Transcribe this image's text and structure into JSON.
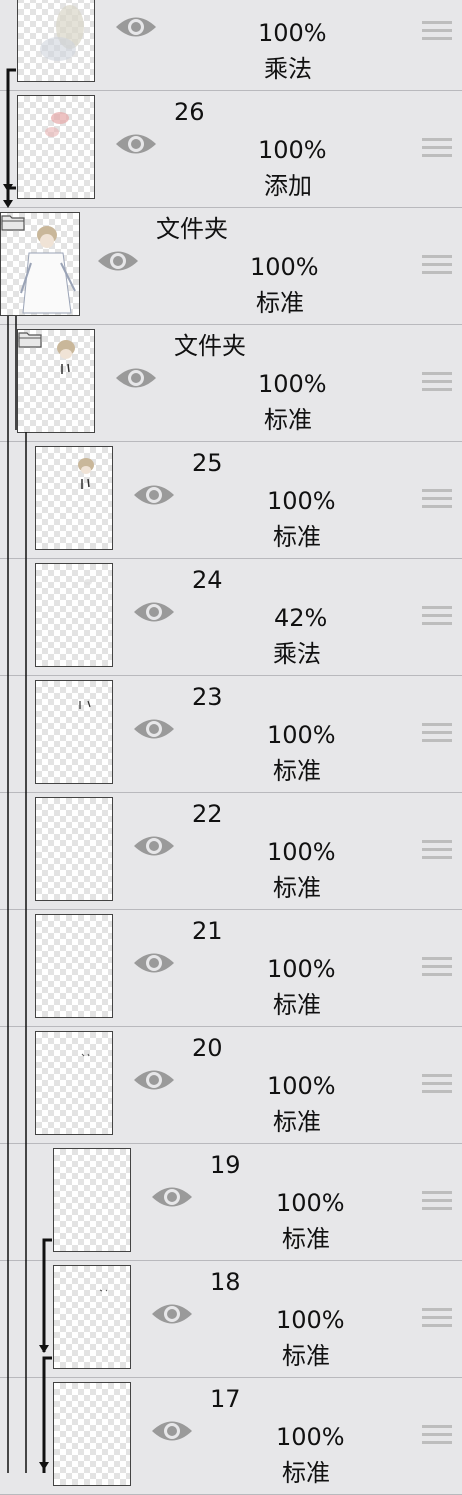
{
  "layers": [
    {
      "name": "",
      "opacity": "100%",
      "blend": "乘法",
      "folder": false
    },
    {
      "name": "26",
      "opacity": "100%",
      "blend": "添加",
      "folder": false
    },
    {
      "name": "文件夹",
      "opacity": "100%",
      "blend": "标准",
      "folder": true
    },
    {
      "name": "文件夹",
      "opacity": "100%",
      "blend": "标准",
      "folder": true
    },
    {
      "name": "25",
      "opacity": "100%",
      "blend": "标准",
      "folder": false
    },
    {
      "name": "24",
      "opacity": "42%",
      "blend": "乘法",
      "folder": false
    },
    {
      "name": "23",
      "opacity": "100%",
      "blend": "标准",
      "folder": false
    },
    {
      "name": "22",
      "opacity": "100%",
      "blend": "标准",
      "folder": false
    },
    {
      "name": "21",
      "opacity": "100%",
      "blend": "标准",
      "folder": false
    },
    {
      "name": "20",
      "opacity": "100%",
      "blend": "标准",
      "folder": false
    },
    {
      "name": "19",
      "opacity": "100%",
      "blend": "标准",
      "folder": false
    },
    {
      "name": "18",
      "opacity": "100%",
      "blend": "标准",
      "folder": false
    },
    {
      "name": "17",
      "opacity": "100%",
      "blend": "标准",
      "folder": false
    }
  ],
  "colors": {
    "background": "#e7e7e9",
    "separator": "#b9b9bd",
    "eye": "#9a9a9a",
    "handle": "#bdbdbd",
    "guide": "#111111"
  }
}
